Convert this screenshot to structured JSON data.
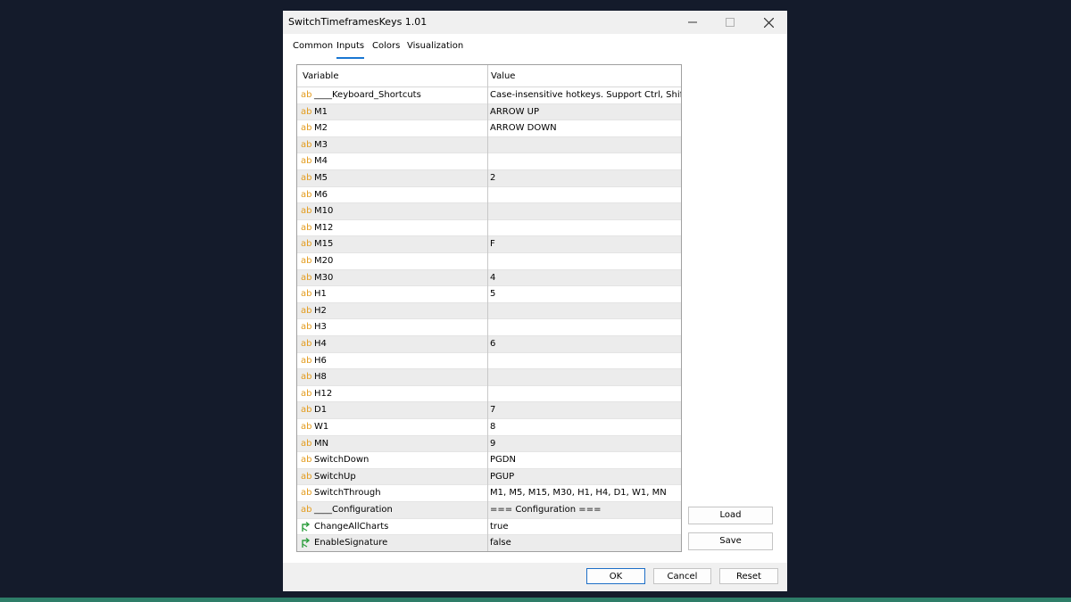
{
  "window": {
    "title": "SwitchTimeframesKeys 1.01"
  },
  "tabs": [
    "Common",
    "Inputs",
    "Colors",
    "Visualization"
  ],
  "active_tab": "Inputs",
  "table": {
    "headers": {
      "variable": "Variable",
      "value": "Value"
    },
    "rows": [
      {
        "icon": "ab",
        "variable": "____Keyboard_Shortcuts",
        "value": "Case-insensitive hotkeys. Support Ctrl, Shift."
      },
      {
        "icon": "ab",
        "variable": "M1",
        "value": "ARROW UP"
      },
      {
        "icon": "ab",
        "variable": "M2",
        "value": "ARROW DOWN"
      },
      {
        "icon": "ab",
        "variable": "M3",
        "value": ""
      },
      {
        "icon": "ab",
        "variable": "M4",
        "value": ""
      },
      {
        "icon": "ab",
        "variable": "M5",
        "value": "2"
      },
      {
        "icon": "ab",
        "variable": "M6",
        "value": ""
      },
      {
        "icon": "ab",
        "variable": "M10",
        "value": ""
      },
      {
        "icon": "ab",
        "variable": "M12",
        "value": ""
      },
      {
        "icon": "ab",
        "variable": "M15",
        "value": "F"
      },
      {
        "icon": "ab",
        "variable": "M20",
        "value": ""
      },
      {
        "icon": "ab",
        "variable": "M30",
        "value": "4"
      },
      {
        "icon": "ab",
        "variable": "H1",
        "value": "5"
      },
      {
        "icon": "ab",
        "variable": "H2",
        "value": ""
      },
      {
        "icon": "ab",
        "variable": "H3",
        "value": ""
      },
      {
        "icon": "ab",
        "variable": "H4",
        "value": "6"
      },
      {
        "icon": "ab",
        "variable": "H6",
        "value": ""
      },
      {
        "icon": "ab",
        "variable": "H8",
        "value": ""
      },
      {
        "icon": "ab",
        "variable": "H12",
        "value": ""
      },
      {
        "icon": "ab",
        "variable": "D1",
        "value": "7"
      },
      {
        "icon": "ab",
        "variable": "W1",
        "value": "8"
      },
      {
        "icon": "ab",
        "variable": "MN",
        "value": "9"
      },
      {
        "icon": "ab",
        "variable": "SwitchDown",
        "value": "PGDN"
      },
      {
        "icon": "ab",
        "variable": "SwitchUp",
        "value": "PGUP"
      },
      {
        "icon": "ab",
        "variable": "SwitchThrough",
        "value": "M1, M5, M15, M30, H1, H4, D1, W1, MN"
      },
      {
        "icon": "ab",
        "variable": "____Configuration",
        "value": "=== Configuration ==="
      },
      {
        "icon": "bool",
        "variable": "ChangeAllCharts",
        "value": "true"
      },
      {
        "icon": "bool",
        "variable": "EnableSignature",
        "value": "false"
      }
    ]
  },
  "buttons": {
    "load": "Load",
    "save": "Save",
    "ok": "OK",
    "cancel": "Cancel",
    "reset": "Reset"
  },
  "colors": {
    "string_icon": "#e39b1c",
    "bool_icon": "#2e9e3e",
    "active_tab_underline": "#1976d2",
    "ok_border": "#1e6fc7"
  }
}
